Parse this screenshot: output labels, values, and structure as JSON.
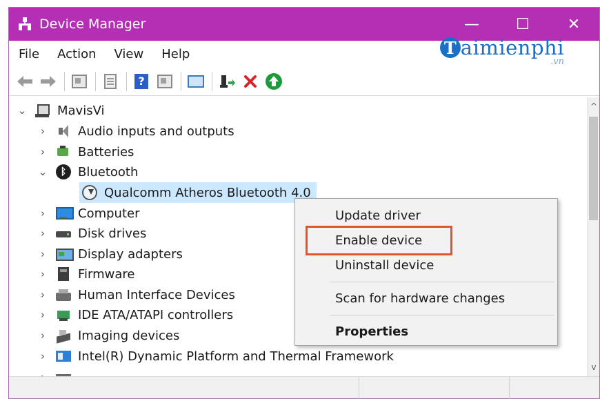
{
  "window": {
    "title": "Device Manager",
    "controls": {
      "minimize": "—",
      "maximize": "☐",
      "close": "✕"
    },
    "title_bar_color": "#b42fb4"
  },
  "menu": {
    "items": [
      "File",
      "Action",
      "View",
      "Help"
    ]
  },
  "brand": {
    "initial": "T",
    "name": "aimienphi",
    "suffix": ".vn"
  },
  "toolbar": {
    "help_glyph": "?",
    "icons": [
      "back-arrow-icon",
      "forward-arrow-icon",
      "properties-pane-icon",
      "document-icon",
      "help-icon",
      "action-pane-icon",
      "monitor-scan-icon",
      "update-driver-icon",
      "uninstall-icon",
      "enable-icon"
    ]
  },
  "tree": {
    "root": {
      "label": "MavisVi",
      "expanded": true
    },
    "categories": [
      {
        "label": "Audio inputs and outputs",
        "expanded": false,
        "icon": "speaker-icon"
      },
      {
        "label": "Batteries",
        "expanded": false,
        "icon": "battery-icon"
      },
      {
        "label": "Bluetooth",
        "expanded": true,
        "icon": "bluetooth-icon"
      },
      {
        "label": "Qualcomm Atheros Bluetooth 4.0",
        "child": true,
        "selected": true,
        "disabled": true,
        "icon": "bluetooth-device-disabled-icon"
      },
      {
        "label": "Computer",
        "expanded": false,
        "icon": "monitor-icon"
      },
      {
        "label": "Disk drives",
        "expanded": false,
        "icon": "disk-drive-icon"
      },
      {
        "label": "Display adapters",
        "expanded": false,
        "icon": "display-adapter-icon"
      },
      {
        "label": "Firmware",
        "expanded": false,
        "icon": "firmware-icon"
      },
      {
        "label": "Human Interface Devices",
        "expanded": false,
        "icon": "hid-icon"
      },
      {
        "label": "IDE ATA/ATAPI controllers",
        "expanded": false,
        "icon": "ide-controller-icon"
      },
      {
        "label": "Imaging devices",
        "expanded": false,
        "icon": "imaging-device-icon"
      },
      {
        "label": "Intel(R) Dynamic Platform and Thermal Framework",
        "expanded": false,
        "icon": "intel-platform-icon"
      }
    ]
  },
  "context_menu": {
    "items": [
      {
        "label": "Update driver"
      },
      {
        "label": "Enable device",
        "highlighted": true
      },
      {
        "label": "Uninstall device"
      },
      {
        "label": "Scan for hardware changes"
      },
      {
        "label": "Properties",
        "bold": true
      }
    ],
    "highlight_color": "#e0552a"
  },
  "scrollbar": {
    "up": "^",
    "down": "v"
  },
  "colors": {
    "selection": "#cce8ff",
    "accent": "#1a6fc7"
  }
}
